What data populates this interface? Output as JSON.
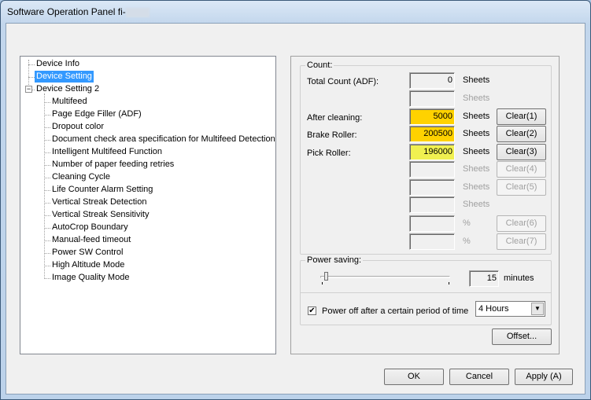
{
  "window": {
    "title": "Software Operation Panel fi-"
  },
  "tree": {
    "items": [
      {
        "label": "Device Info",
        "level": 0
      },
      {
        "label": "Device Setting",
        "level": 0,
        "selected": true
      },
      {
        "label": "Device Setting 2",
        "level": 0,
        "expanded": true
      },
      {
        "label": "Multifeed",
        "level": 1
      },
      {
        "label": "Page Edge Filler (ADF)",
        "level": 1
      },
      {
        "label": "Dropout color",
        "level": 1
      },
      {
        "label": "Document check area specification for Multifeed Detection",
        "level": 1
      },
      {
        "label": "Intelligent Multifeed Function",
        "level": 1
      },
      {
        "label": "Number of paper feeding retries",
        "level": 1
      },
      {
        "label": "Cleaning Cycle",
        "level": 1
      },
      {
        "label": "Life Counter Alarm Setting",
        "level": 1
      },
      {
        "label": "Vertical Streak Detection",
        "level": 1
      },
      {
        "label": "Vertical Streak Sensitivity",
        "level": 1
      },
      {
        "label": "AutoCrop Boundary",
        "level": 1
      },
      {
        "label": "Manual-feed timeout",
        "level": 1
      },
      {
        "label": "Power SW Control",
        "level": 1
      },
      {
        "label": "High Altitude Mode",
        "level": 1
      },
      {
        "label": "Image Quality Mode",
        "level": 1
      }
    ]
  },
  "count": {
    "legend": "Count:",
    "rows": [
      {
        "label": "Total Count (ADF):",
        "value": "0",
        "unit": "Sheets",
        "enabled": true,
        "highlight": ""
      },
      {
        "label": "",
        "value": "",
        "unit": "Sheets",
        "enabled": false,
        "highlight": ""
      },
      {
        "label": "After cleaning:",
        "value": "5000",
        "unit": "Sheets",
        "enabled": true,
        "button": "Clear(1)",
        "highlight": "#ffd200"
      },
      {
        "label": "Brake Roller:",
        "value": "200500",
        "unit": "Sheets",
        "enabled": true,
        "button": "Clear(2)",
        "highlight": "#ffd200"
      },
      {
        "label": "Pick Roller:",
        "value": "196000",
        "unit": "Sheets",
        "enabled": true,
        "button": "Clear(3)",
        "highlight": "#f0f050"
      },
      {
        "label": "",
        "value": "",
        "unit": "Sheets",
        "enabled": false,
        "button": "Clear(4)",
        "highlight": ""
      },
      {
        "label": "",
        "value": "",
        "unit": "Sheets",
        "enabled": false,
        "button": "Clear(5)",
        "highlight": ""
      },
      {
        "label": "",
        "value": "",
        "unit": "Sheets",
        "enabled": false,
        "highlight": ""
      },
      {
        "label": "",
        "value": "",
        "unit": "%",
        "enabled": false,
        "button": "Clear(6)",
        "highlight": ""
      },
      {
        "label": "",
        "value": "",
        "unit": "%",
        "enabled": false,
        "button": "Clear(7)",
        "highlight": ""
      }
    ]
  },
  "power": {
    "legend": "Power saving:",
    "minutes": "15",
    "minutes_label": "minutes",
    "slider_fraction": 0.03,
    "power_off_label": "Power off after a certain period of time",
    "power_off_checked": true,
    "power_off_value": "4 Hours"
  },
  "buttons": {
    "offset": "Offset...",
    "ok": "OK",
    "cancel": "Cancel",
    "apply": "Apply (A)"
  }
}
